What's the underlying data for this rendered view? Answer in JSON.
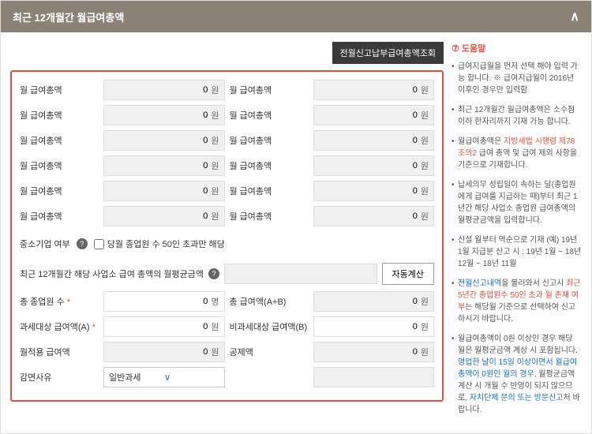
{
  "header": {
    "title": "최근 12개월간 월급여총액"
  },
  "topBtn": "전월신고납부급여총액조회",
  "salaryLabel": "월 급여총액",
  "salaryValue": "0",
  "unit": "원",
  "personUnit": "명",
  "sme": {
    "label": "중소기업 여부",
    "checkboxLabel": "당월 종업원 수 50인 초과만 해당"
  },
  "avg": {
    "label": "최근 12개월간 해당 사업소 급여 총액의 월평균금액",
    "btn": "자동계산"
  },
  "fields": {
    "totalEmployees": "총 종업원 수",
    "totalPay": "총 급여액(A+B)",
    "taxablePay": "과세대상 급여액(A)",
    "nonTaxablePay": "비과세대상 급여액(B)",
    "monthlyPay": "월적용 급여액",
    "deduction": "공제액",
    "reductionReason": "감면사유"
  },
  "selectValue": "일반과세",
  "help": {
    "title": "도움말",
    "items": [
      {
        "text": "급여지급월을 먼저 선택 해야 입력 가능 합니다.\n※ 급여지급월이 2016년 이후인 경우만 입력함"
      },
      {
        "text": "최근 12개월간 월급여총액은 소수점 이하 한자리까지 기재 가능 합니다."
      },
      {
        "prefix": "월급여총액은 ",
        "link": "지방세법 시행령 제78조의2",
        "suffix": " 급여 총액 및 급여 제외 사항을 기준으로 기재합니다.",
        "linkRed": true
      },
      {
        "text": "납세의무 성립일이 속하는 달(종업원에게 급여를 지급하는 때)부터 최근 1년간 해당 사업소 종업원 급여총액의 월평균금액을 입력합니다."
      },
      {
        "text": "신설 월부터 역순으로 기재\n(예) 19년 1월 지급분 신고 시 : 19년 1월 ~ 18년 12월 ~ 18년 11월"
      },
      {
        "prefix": "",
        "link": "전월신고내역",
        "mid": "을 불러와서 신고시 ",
        "red": "최근 5년간 종업원수 50인 초과 월 존재 여부",
        "suffix": "는 해당월 기준으로 선택하여 신고하시기 바랍니다."
      },
      {
        "prefix": "월급여총액이 0원 이상인 경우 해당 월은 월평균금액 계상 시 포함됩니다. ",
        "link": "영업한 날이 15일 이상이면서 월급여 총액이 0원인 월의 경우",
        "suffix": ", 월평균금액 계산 시 개월 수 반영이 되지 않으므로, ",
        "link2": "자치단체 문의 또는 방문신고",
        "suffix2": "처 바랍니다."
      }
    ]
  }
}
